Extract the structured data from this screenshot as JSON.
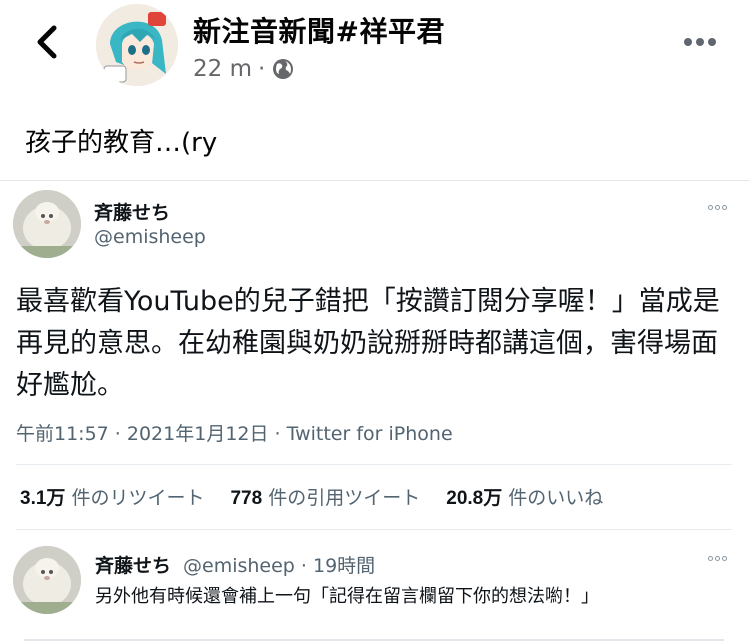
{
  "post": {
    "page_name": "新注音新聞#祥平君",
    "time": "22 m",
    "separator": "·",
    "text": "孩子的教育…(ry"
  },
  "tweet": {
    "author_name": "斉藤せち",
    "author_handle": "@emisheep",
    "body": "最喜歡看YouTube的兒子錯把「按讚訂閱分享喔！」當成是再見的意思。在幼稚園與奶奶說掰掰時都講這個，害得場面好尷尬。",
    "timestamp": "午前11:57 · 2021年1月12日 · Twitter for iPhone",
    "stats": [
      {
        "value": "3.1万",
        "label": "件のリツイート"
      },
      {
        "value": "778",
        "label": "件の引用ツイート"
      },
      {
        "value": "20.8万",
        "label": "件のいいね"
      }
    ]
  },
  "reply": {
    "author_name": "斉藤せち",
    "author_handle": "@emisheep · 19時間",
    "body": "另外他有時候還會補上一句「記得在留言欄留下你的想法喲！」"
  },
  "icons": {
    "back": "chevron-left-icon",
    "globe": "globe-icon",
    "more": "ellipsis-icon"
  },
  "colors": {
    "secondary_text": "#65676b",
    "twitter_secondary": "#536471"
  }
}
